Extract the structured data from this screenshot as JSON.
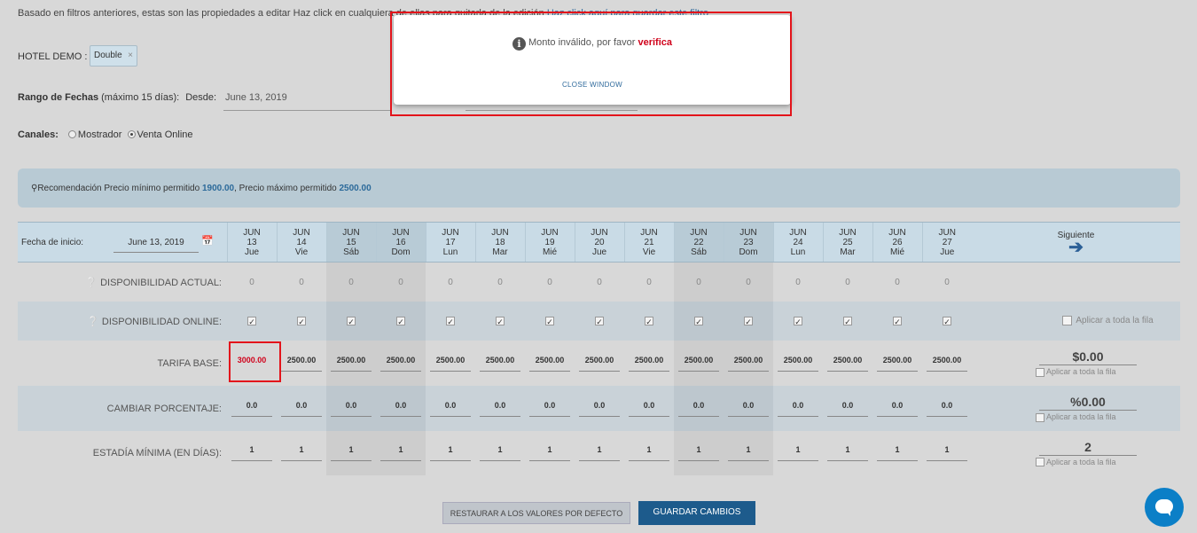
{
  "top_info": {
    "text": "Basado en filtros anteriores, estas son las propiedades a editar Haz click en cualquiera de ellas para quitarla de la edición",
    "link": "Haz click aquí para guardar este filtro"
  },
  "hotel": {
    "label": "HOTEL DEMO :",
    "tag": "Double",
    "tag_remove": "×"
  },
  "range": {
    "label_bold": "Rango de Fechas",
    "label_rest": "(máximo 15 días):",
    "desde_label": "Desde:",
    "desde_value": "June 13, 2019"
  },
  "channels": {
    "label": "Canales:",
    "options": [
      "Mostrador",
      "Venta Online"
    ],
    "selected": "Venta Online"
  },
  "recommendation": {
    "icon": "lightbulb-icon",
    "prefix": "Recomendación Precio mínimo permitido",
    "min": "1900.00",
    "middle": ", Precio máximo permitido",
    "max": "2500.00"
  },
  "grid": {
    "fecha_label": "Fecha de inicio:",
    "fecha_value": "June 13, 2019",
    "siguiente": "Siguiente",
    "siguiente_arrow": "➔",
    "days": [
      {
        "month": "JUN",
        "day": "13",
        "dow": "Jue"
      },
      {
        "month": "JUN",
        "day": "14",
        "dow": "Vie"
      },
      {
        "month": "JUN",
        "day": "15",
        "dow": "Sáb"
      },
      {
        "month": "JUN",
        "day": "16",
        "dow": "Dom"
      },
      {
        "month": "JUN",
        "day": "17",
        "dow": "Lun"
      },
      {
        "month": "JUN",
        "day": "18",
        "dow": "Mar"
      },
      {
        "month": "JUN",
        "day": "19",
        "dow": "Mié"
      },
      {
        "month": "JUN",
        "day": "20",
        "dow": "Jue"
      },
      {
        "month": "JUN",
        "day": "21",
        "dow": "Vie"
      },
      {
        "month": "JUN",
        "day": "22",
        "dow": "Sáb"
      },
      {
        "month": "JUN",
        "day": "23",
        "dow": "Dom"
      },
      {
        "month": "JUN",
        "day": "24",
        "dow": "Lun"
      },
      {
        "month": "JUN",
        "day": "25",
        "dow": "Mar"
      },
      {
        "month": "JUN",
        "day": "26",
        "dow": "Mié"
      },
      {
        "month": "JUN",
        "day": "27",
        "dow": "Jue"
      }
    ],
    "rows": {
      "disp_actual": {
        "label": "DISPONIBILIDAD ACTUAL:",
        "values": [
          "0",
          "0",
          "0",
          "0",
          "0",
          "0",
          "0",
          "0",
          "0",
          "0",
          "0",
          "0",
          "0",
          "0",
          "0"
        ]
      },
      "disp_online": {
        "label": "DISPONIBILIDAD ONLINE:",
        "check": "✓",
        "apply": "Aplicar a toda la fila"
      },
      "tarifa": {
        "label": "TARIFA BASE:",
        "values": [
          "3000.00",
          "2500.00",
          "2500.00",
          "2500.00",
          "2500.00",
          "2500.00",
          "2500.00",
          "2500.00",
          "2500.00",
          "2500.00",
          "2500.00",
          "2500.00",
          "2500.00",
          "2500.00",
          "2500.00"
        ],
        "summary": "$0.00",
        "apply": "Aplicar a toda la fila"
      },
      "porcentaje": {
        "label": "CAMBIAR PORCENTAJE:",
        "values": [
          "0.0",
          "0.0",
          "0.0",
          "0.0",
          "0.0",
          "0.0",
          "0.0",
          "0.0",
          "0.0",
          "0.0",
          "0.0",
          "0.0",
          "0.0",
          "0.0",
          "0.0"
        ],
        "summary": "%0.00",
        "apply": "Aplicar a toda la fila"
      },
      "estadia": {
        "label": "ESTADÍA MÍNIMA (EN DÍAS):",
        "values": [
          "1",
          "1",
          "1",
          "1",
          "1",
          "1",
          "1",
          "1",
          "1",
          "1",
          "1",
          "1",
          "1",
          "1",
          "1"
        ],
        "summary": "2",
        "apply": "Aplicar a toda la fila"
      }
    }
  },
  "modal": {
    "message": "Monto inválido, por favor",
    "emphasis": "verifica",
    "close": "CLOSE WINDOW"
  },
  "buttons": {
    "restore": "RESTAURAR A LOS VALORES POR DEFECTO",
    "save": "GUARDAR CAMBIOS"
  },
  "colors": {
    "accent": "#1d5b8c",
    "error": "#d0021b",
    "highlight_border": "#e3141b",
    "chat": "#0b7fc7"
  }
}
